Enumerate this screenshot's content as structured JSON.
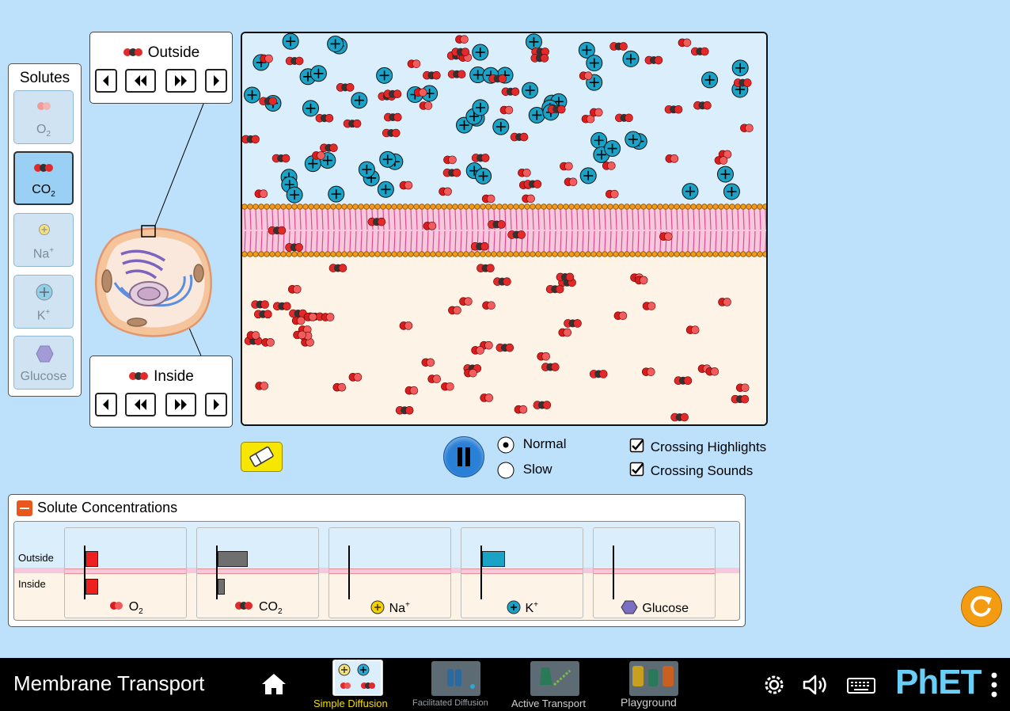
{
  "app": {
    "title": "Membrane Transport",
    "brand": "PhET"
  },
  "solutes_panel": {
    "title": "Solutes",
    "items": [
      {
        "label": "O",
        "sub": "2",
        "selected": false
      },
      {
        "label": "CO",
        "sub": "2",
        "selected": true
      },
      {
        "label": "Na",
        "sup": "+",
        "selected": false
      },
      {
        "label": "K",
        "sup": "+",
        "selected": false
      },
      {
        "label": "Glucose",
        "selected": false
      }
    ]
  },
  "outside_panel": {
    "title": "Outside"
  },
  "inside_panel": {
    "title": "Inside"
  },
  "sim_controls": {
    "speed_options": [
      "Normal",
      "Slow"
    ],
    "speed_selected": "Normal",
    "checkboxes": [
      {
        "label": "Crossing Highlights",
        "checked": true
      },
      {
        "label": "Crossing Sounds",
        "checked": true
      }
    ]
  },
  "concentrations": {
    "title": "Solute Concentrations",
    "outside_label": "Outside",
    "inside_label": "Inside",
    "solutes": [
      {
        "label": "O",
        "sub": "2",
        "sup": "",
        "outside": 0.18,
        "inside": 0.18,
        "color": "#ee1f1f"
      },
      {
        "label": "CO",
        "sub": "2",
        "sup": "",
        "outside": 0.42,
        "inside": 0.1,
        "color": "#6f6f6f"
      },
      {
        "label": "Na",
        "sub": "",
        "sup": "+",
        "outside": 0,
        "inside": 0,
        "color": "#f5d000"
      },
      {
        "label": "K",
        "sub": "",
        "sup": "+",
        "outside": 0.32,
        "inside": 0,
        "color": "#1aa2c7"
      },
      {
        "label": "Glucose",
        "sub": "",
        "sup": "",
        "outside": 0,
        "inside": 0,
        "color": "#7b6fc4"
      }
    ]
  },
  "navbar": {
    "screens": [
      "Simple Diffusion",
      "Facilitated Diffusion",
      "Active Transport",
      "Playground"
    ],
    "selected": "Simple Diffusion"
  },
  "colors": {
    "background": "#bde0fb",
    "outside": "#daeefc",
    "inside": "#fdf3e7",
    "selected_tab_label": "#f5de00",
    "reset_button": "#f39c12",
    "oxygen": "#ee1f1f",
    "potassium": "#1aa2c7"
  }
}
